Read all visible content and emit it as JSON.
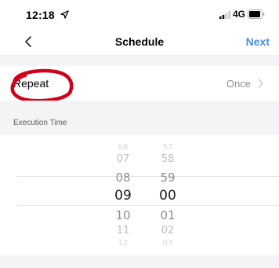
{
  "status_bar": {
    "time": "12:18",
    "network": "4G"
  },
  "nav": {
    "title": "Schedule",
    "next_label": "Next"
  },
  "repeat": {
    "label": "Repeat",
    "value": "Once"
  },
  "execution": {
    "label": "Execution Time"
  },
  "picker": {
    "hours": [
      "06",
      "07",
      "08",
      "09",
      "10",
      "11",
      "12"
    ],
    "minutes": [
      "57",
      "58",
      "59",
      "00",
      "01",
      "02",
      "03"
    ],
    "selected_hour": "09",
    "selected_minute": "00"
  },
  "colors": {
    "accent": "#4a90e2",
    "annotation": "#d0021b",
    "separator_bg": "#f4f4f6"
  },
  "icons": [
    "location-arrow-icon",
    "signal-icon",
    "battery-icon",
    "back-chevron-icon",
    "chevron-right-icon"
  ]
}
